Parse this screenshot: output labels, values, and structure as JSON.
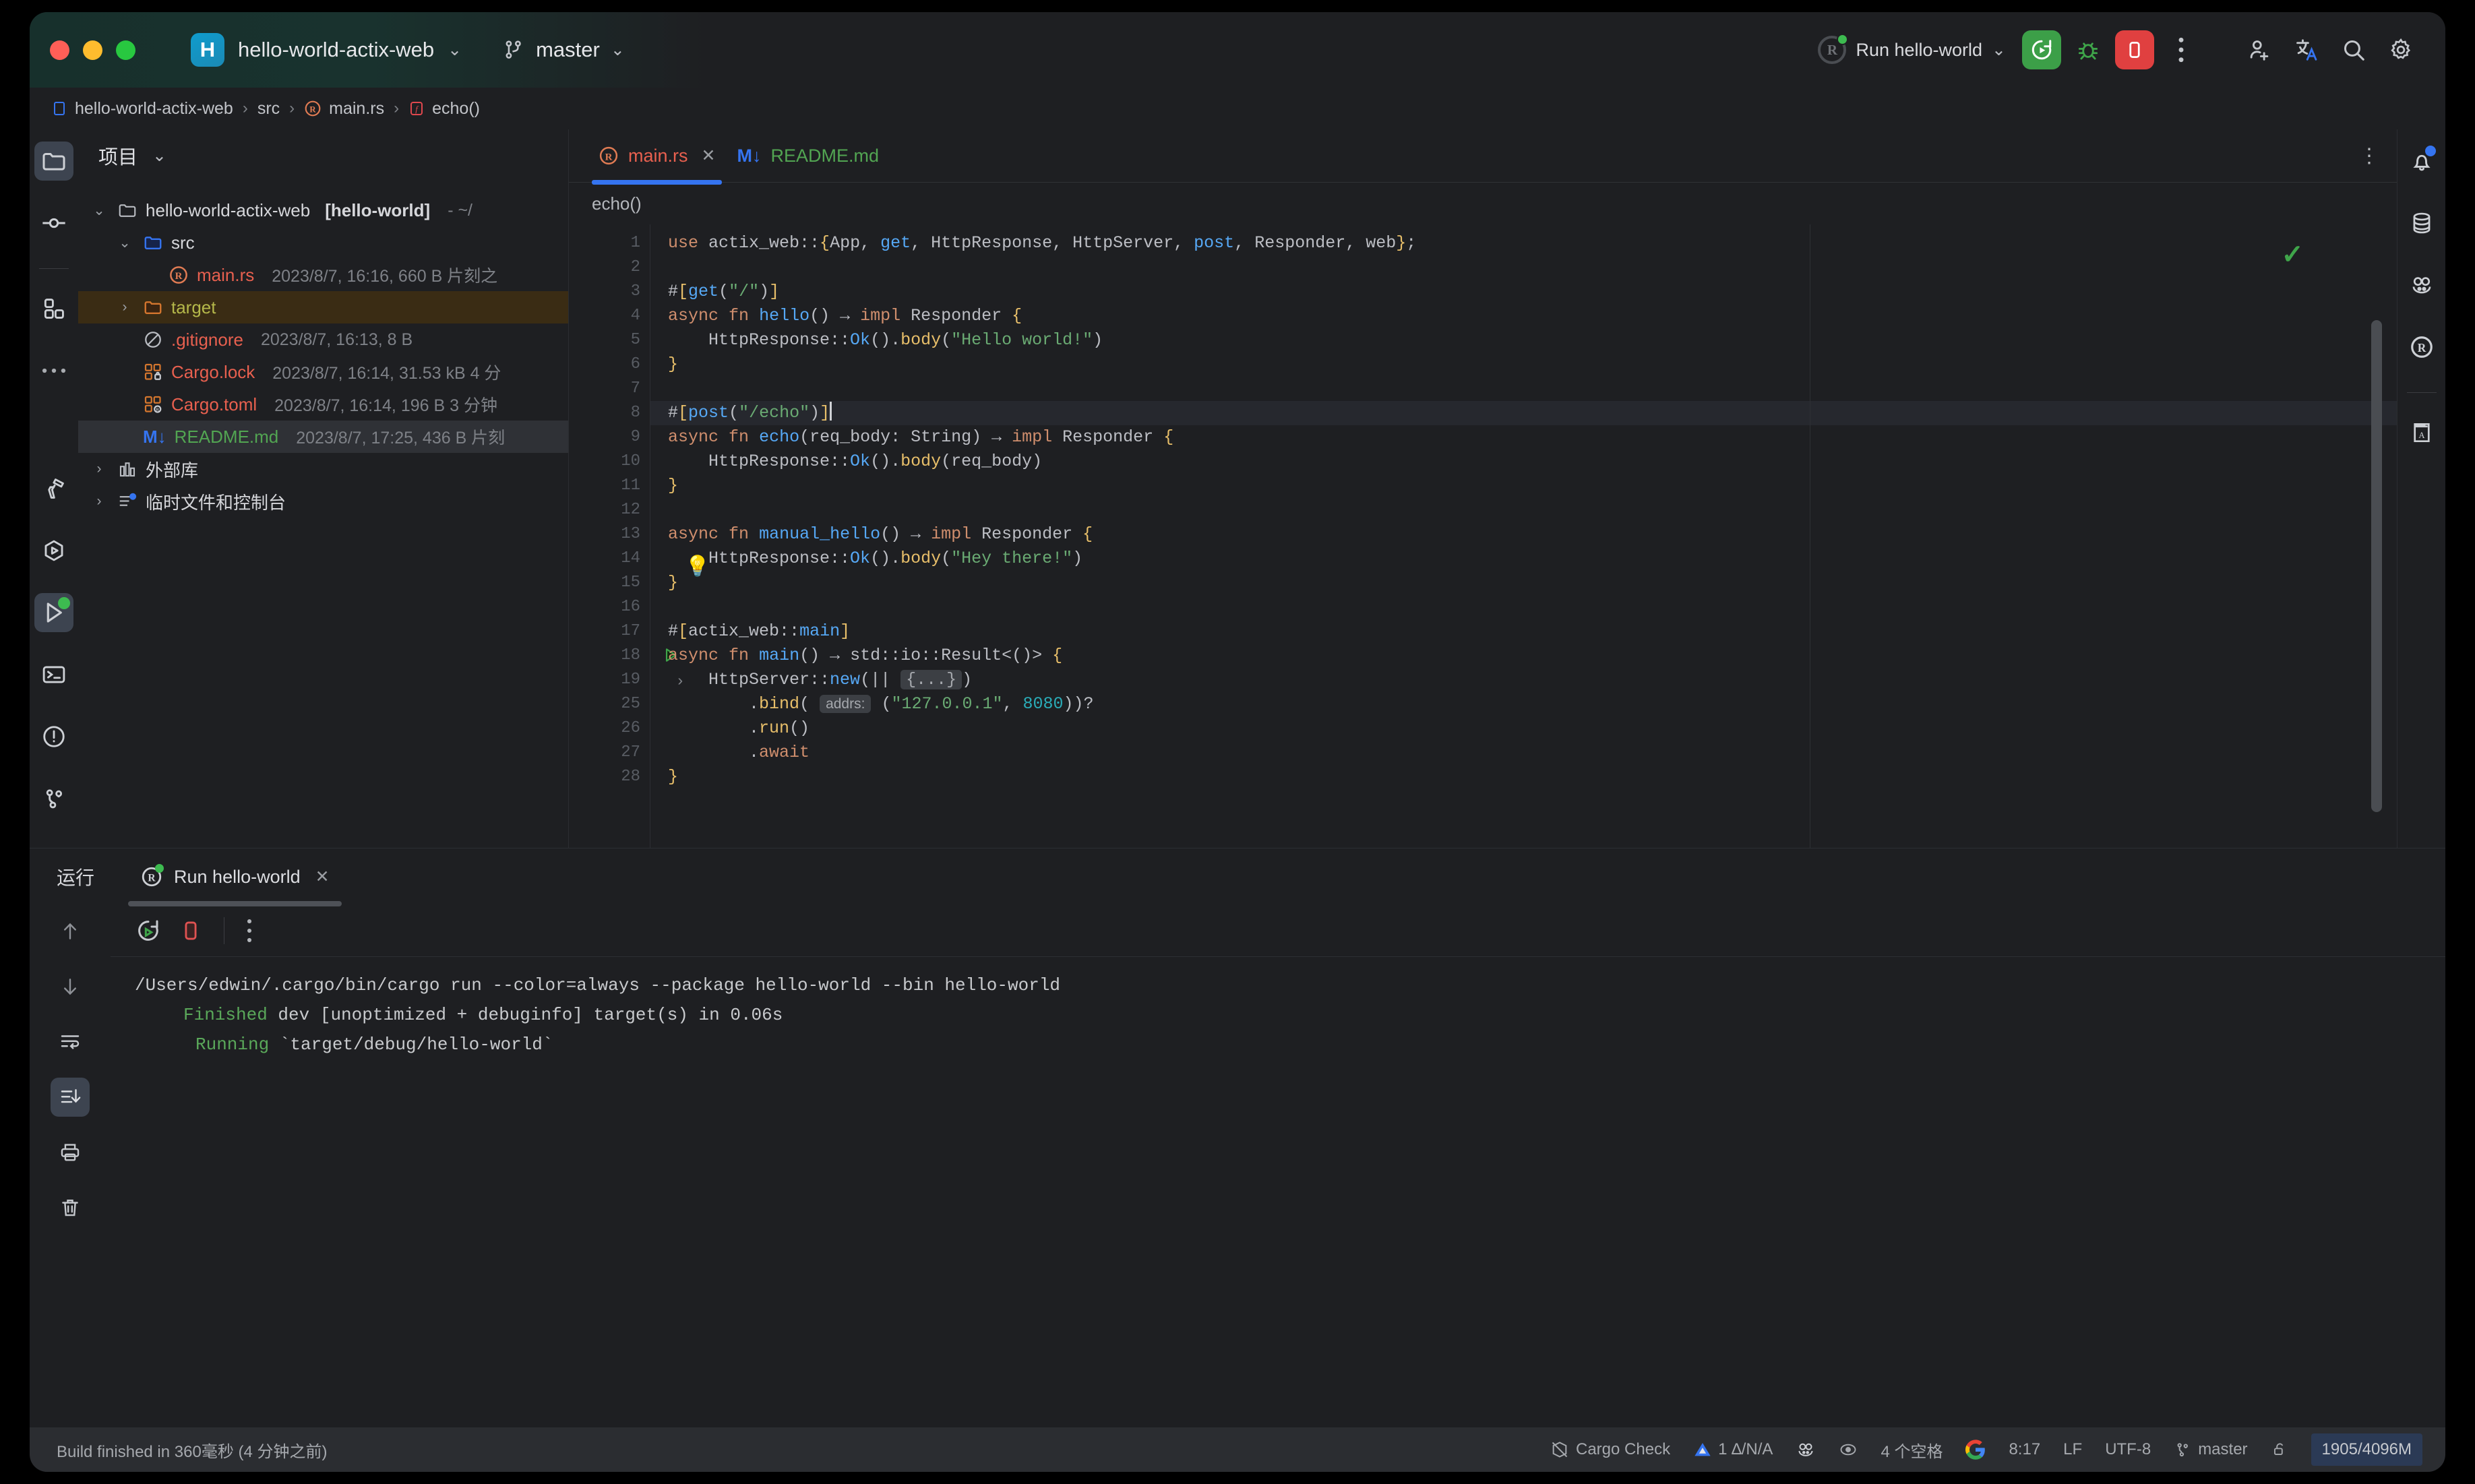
{
  "titlebar": {
    "project_icon_letter": "H",
    "project_name": "hello-world-actix-web",
    "branch": "master",
    "run_config": "Run hello-world"
  },
  "breadcrumb": {
    "items": [
      "hello-world-actix-web",
      "src",
      "main.rs",
      "echo()"
    ]
  },
  "project_panel": {
    "title": "项目",
    "tree": [
      {
        "label": "hello-world-actix-web",
        "bracket": "[hello-world]",
        "meta": "- ~/",
        "arrow": "v",
        "indent": 0,
        "kind": "root"
      },
      {
        "label": "src",
        "meta": "",
        "arrow": "v",
        "indent": 1,
        "kind": "folder-blue"
      },
      {
        "label": "main.rs",
        "meta": "2023/8/7, 16:16, 660 B 片刻之",
        "arrow": "",
        "indent": 2,
        "kind": "rust"
      },
      {
        "label": "target",
        "meta": "",
        "arrow": ">",
        "indent": 1,
        "kind": "folder-orange"
      },
      {
        "label": ".gitignore",
        "meta": "2023/8/7, 16:13, 8 B",
        "arrow": "",
        "indent": 1,
        "kind": "gitignore"
      },
      {
        "label": "Cargo.lock",
        "meta": "2023/8/7, 16:14, 31.53 kB 4 分",
        "arrow": "",
        "indent": 1,
        "kind": "lock"
      },
      {
        "label": "Cargo.toml",
        "meta": "2023/8/7, 16:14, 196 B 3 分钟",
        "arrow": "",
        "indent": 1,
        "kind": "toml"
      },
      {
        "label": "README.md",
        "meta": "2023/8/7, 17:25, 436 B 片刻",
        "arrow": "",
        "indent": 1,
        "kind": "md"
      },
      {
        "label": "外部库",
        "meta": "",
        "arrow": ">",
        "indent": 0,
        "kind": "lib"
      },
      {
        "label": "临时文件和控制台",
        "meta": "",
        "arrow": ">",
        "indent": 0,
        "kind": "scratch"
      }
    ]
  },
  "editor": {
    "tabs": [
      {
        "label": "main.rs",
        "type": "rs",
        "active": true,
        "closable": true
      },
      {
        "label": "README.md",
        "type": "md",
        "active": false,
        "closable": false
      }
    ],
    "function_breadcrumb": "echo()",
    "lines": [
      {
        "num": "1",
        "text": "use actix_web::{App, get, HttpResponse, HttpServer, post, Responder, web};"
      },
      {
        "num": "2",
        "text": ""
      },
      {
        "num": "3",
        "text": "#[get(\"/\")]"
      },
      {
        "num": "4",
        "text": "async fn hello() -> impl Responder {"
      },
      {
        "num": "5",
        "text": "    HttpResponse::Ok().body(\"Hello world!\")"
      },
      {
        "num": "6",
        "text": "}"
      },
      {
        "num": "7",
        "text": ""
      },
      {
        "num": "8",
        "text": "#[post(\"/echo\")]",
        "highlight": true
      },
      {
        "num": "9",
        "text": "async fn echo(req_body: String) -> impl Responder {"
      },
      {
        "num": "10",
        "text": "    HttpResponse::Ok().body(req_body)"
      },
      {
        "num": "11",
        "text": "}"
      },
      {
        "num": "12",
        "text": ""
      },
      {
        "num": "13",
        "text": "async fn manual_hello() -> impl Responder {"
      },
      {
        "num": "14",
        "text": "    HttpResponse::Ok().body(\"Hey there!\")"
      },
      {
        "num": "15",
        "text": "}"
      },
      {
        "num": "16",
        "text": ""
      },
      {
        "num": "17",
        "text": "#[actix_web::main]"
      },
      {
        "num": "18",
        "text": "async fn main() -> std::io::Result<()> {",
        "run_marker": true
      },
      {
        "num": "19",
        "text": "    HttpServer::new(|| {...})",
        "fold_marker": true
      },
      {
        "num": "25",
        "text": "        .bind( addrs: (\"127.0.0.1\", 8080))?"
      },
      {
        "num": "26",
        "text": "        .run()"
      },
      {
        "num": "27",
        "text": "        .await"
      },
      {
        "num": "28",
        "text": "}"
      }
    ],
    "param_hint": "addrs:"
  },
  "run_panel": {
    "section_label": "运行",
    "tab_label": "Run hello-world",
    "console_lines": [
      {
        "text": "/Users/edwin/.cargo/bin/cargo run --color=always --package hello-world --bin hello-world",
        "type": "plain"
      },
      {
        "prefix": "Finished",
        "text": " dev [unoptimized + debuginfo] target(s) in 0.06s",
        "type": "ok",
        "indent": 1
      },
      {
        "prefix": "Running",
        "text": " `target/debug/hello-world`",
        "type": "ok",
        "indent": 2
      }
    ]
  },
  "statusbar": {
    "left": "Build finished in 360毫秒 (4 分钟之前)",
    "cargo_check": "Cargo Check",
    "inspections": "1 ∆/N/A",
    "indent": "4 个空格",
    "time": "8:17",
    "line_sep": "LF",
    "encoding": "UTF-8",
    "branch": "master",
    "memory": "1905/4096M"
  },
  "colors": {
    "accent_blue": "#3574f0",
    "run_green": "#3c9f48",
    "stop_red": "#e04040",
    "bg": "#1e1f22",
    "statusbar_bg": "#2b2d31"
  },
  "icons": {
    "project_rail": [
      "folder-icon",
      "commit-icon",
      "plugins-icon",
      "more-icon"
    ],
    "project_rail_bottom": [
      "build-hammer-icon",
      "run-anything-icon",
      "run-icon",
      "terminal-icon",
      "problems-icon",
      "git-branch-icon"
    ],
    "right_rail": [
      "notifications-bell-icon",
      "database-icon",
      "plugins-face-icon",
      "rust-icon",
      "dictionary-icon"
    ],
    "run_rail": [
      "scroll-up-icon",
      "scroll-down-icon",
      "soft-wrap-icon",
      "scroll-to-end-icon",
      "print-icon",
      "trash-icon"
    ],
    "toolbar": [
      "rerun-icon",
      "bug-icon",
      "stop-icon",
      "more-vertical-icon",
      "add-user-icon",
      "translate-icon",
      "search-icon",
      "settings-gear-icon"
    ]
  }
}
